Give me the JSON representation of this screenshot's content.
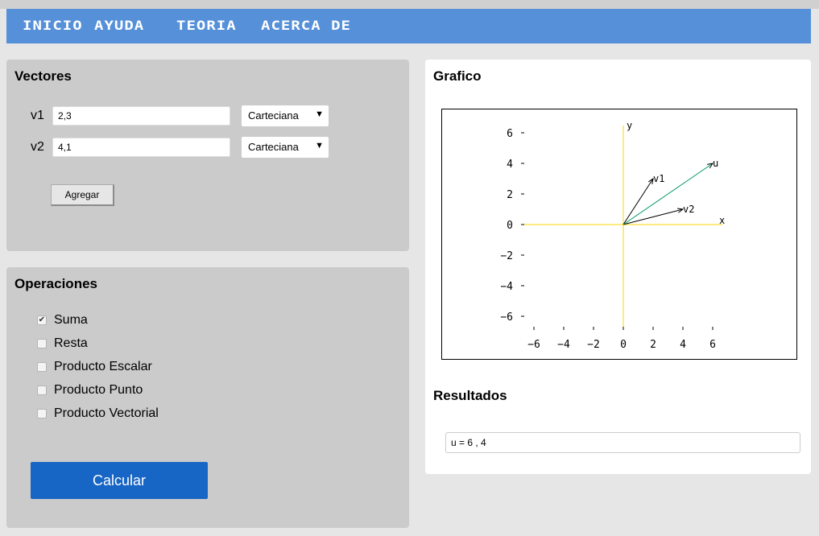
{
  "nav": {
    "items": [
      {
        "label": "INICIO"
      },
      {
        "label": "AYUDA"
      },
      {
        "label": "TEORIA"
      },
      {
        "label": "ACERCA DE"
      }
    ]
  },
  "vectores": {
    "title": "Vectores",
    "rows": [
      {
        "label": "v1",
        "value": "2,3",
        "mode": "Carteciana"
      },
      {
        "label": "v2",
        "value": "4,1",
        "mode": "Carteciana"
      }
    ],
    "add_button": "Agregar"
  },
  "operaciones": {
    "title": "Operaciones",
    "options": [
      {
        "label": "Suma",
        "checked": true
      },
      {
        "label": "Resta",
        "checked": false
      },
      {
        "label": "Producto Escalar",
        "checked": false
      },
      {
        "label": "Producto Punto",
        "checked": false
      },
      {
        "label": "Producto Vectorial",
        "checked": false
      }
    ],
    "calc_button": "Calcular"
  },
  "grafico": {
    "title": "Grafico",
    "x_axis_label": "x",
    "y_axis_label": "y",
    "x_ticks": [
      "−6",
      "−4",
      "−2",
      "0",
      "2",
      "4",
      "6"
    ],
    "y_ticks": [
      "6",
      "4",
      "2",
      "0",
      "−2",
      "−4",
      "−6"
    ],
    "axis_color": "#ffd700",
    "vectors": [
      {
        "name": "v1",
        "x": 2,
        "y": 3,
        "color": "#000000"
      },
      {
        "name": "v2",
        "x": 4,
        "y": 1,
        "color": "#000000"
      },
      {
        "name": "u",
        "x": 6,
        "y": 4,
        "color": "#009966"
      }
    ]
  },
  "resultados": {
    "title": "Resultados",
    "value": "u = 6 , 4"
  },
  "colors": {
    "navbar": "#5590d9",
    "calc_button": "#1765c4",
    "panel_grey": "#cbcbcb"
  }
}
